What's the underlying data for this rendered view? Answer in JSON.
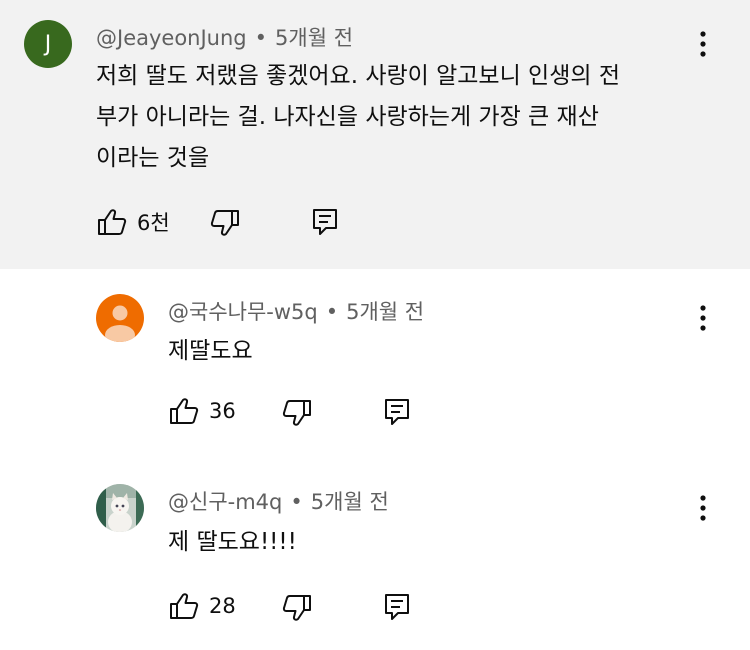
{
  "comments": [
    {
      "avatar_letter": "J",
      "author": "@JeayeonJung",
      "time": "5개월 전",
      "text_lines": [
        "저희 딸도 저랬음 좋겠어요. 사랑이 알고보니 인생의 전",
        "부가 아니라는 걸.  나자신을 사랑하는게 가장 큰 재산",
        "이라는 것을"
      ],
      "likes": "6천"
    },
    {
      "author": "@국수나무-w5q",
      "time": "5개월 전",
      "text_lines": [
        "제딸도요"
      ],
      "likes": "36"
    },
    {
      "author": "@신구-m4q",
      "time": "5개월 전",
      "text_lines": [
        "제 딸도요!!!!"
      ],
      "likes": "28"
    }
  ],
  "separator": "•",
  "colors": {
    "main_bg": "#f2f2f2",
    "avatar_green": "#38691e",
    "avatar_orange": "#ef6c00",
    "meta_gray": "#606060"
  },
  "icons": [
    "like-icon",
    "dislike-icon",
    "reply-icon",
    "more-vert-icon"
  ]
}
